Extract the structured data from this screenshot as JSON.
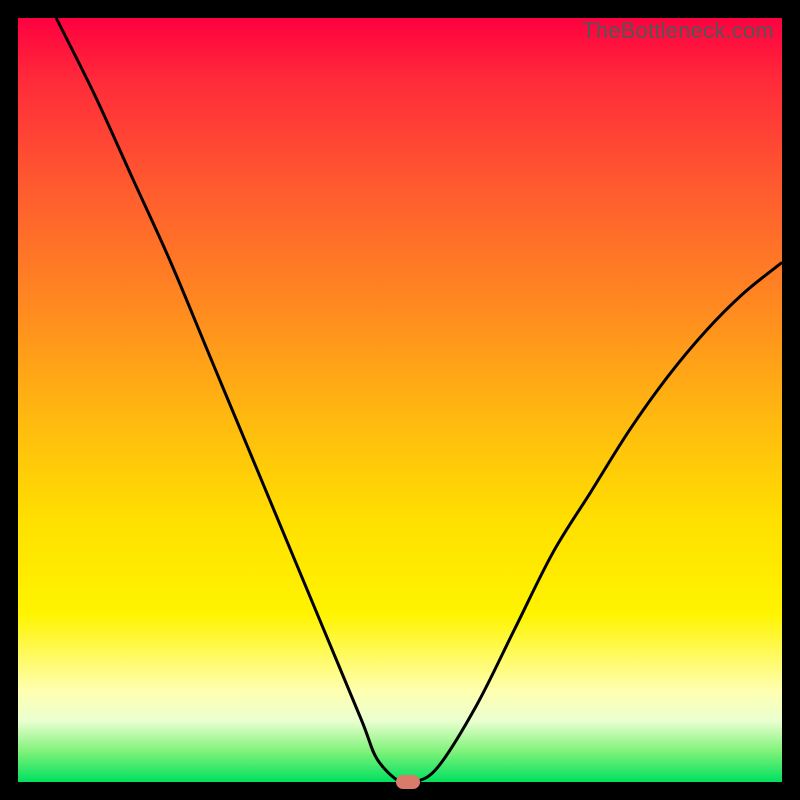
{
  "watermark": "TheBottleneck.com",
  "colors": {
    "frame": "#000000",
    "gradient_top": "#ff0040",
    "gradient_bottom": "#00e060",
    "curve": "#000000",
    "marker": "#d97a6a"
  },
  "chart_data": {
    "type": "line",
    "title": "",
    "xlabel": "",
    "ylabel": "",
    "xlim": [
      0,
      100
    ],
    "ylim": [
      0,
      100
    ],
    "x": [
      5,
      10,
      15,
      20,
      25,
      30,
      35,
      40,
      45,
      47,
      50,
      52,
      55,
      60,
      65,
      70,
      75,
      80,
      85,
      90,
      95,
      100
    ],
    "values": [
      100,
      90,
      79,
      68,
      56,
      44,
      32,
      20,
      8,
      3,
      0,
      0,
      2,
      10,
      20,
      30,
      38,
      46,
      53,
      59,
      64,
      68
    ],
    "marker": {
      "x": 51,
      "y": 0
    },
    "flat_bottom_range": [
      48,
      54
    ]
  }
}
